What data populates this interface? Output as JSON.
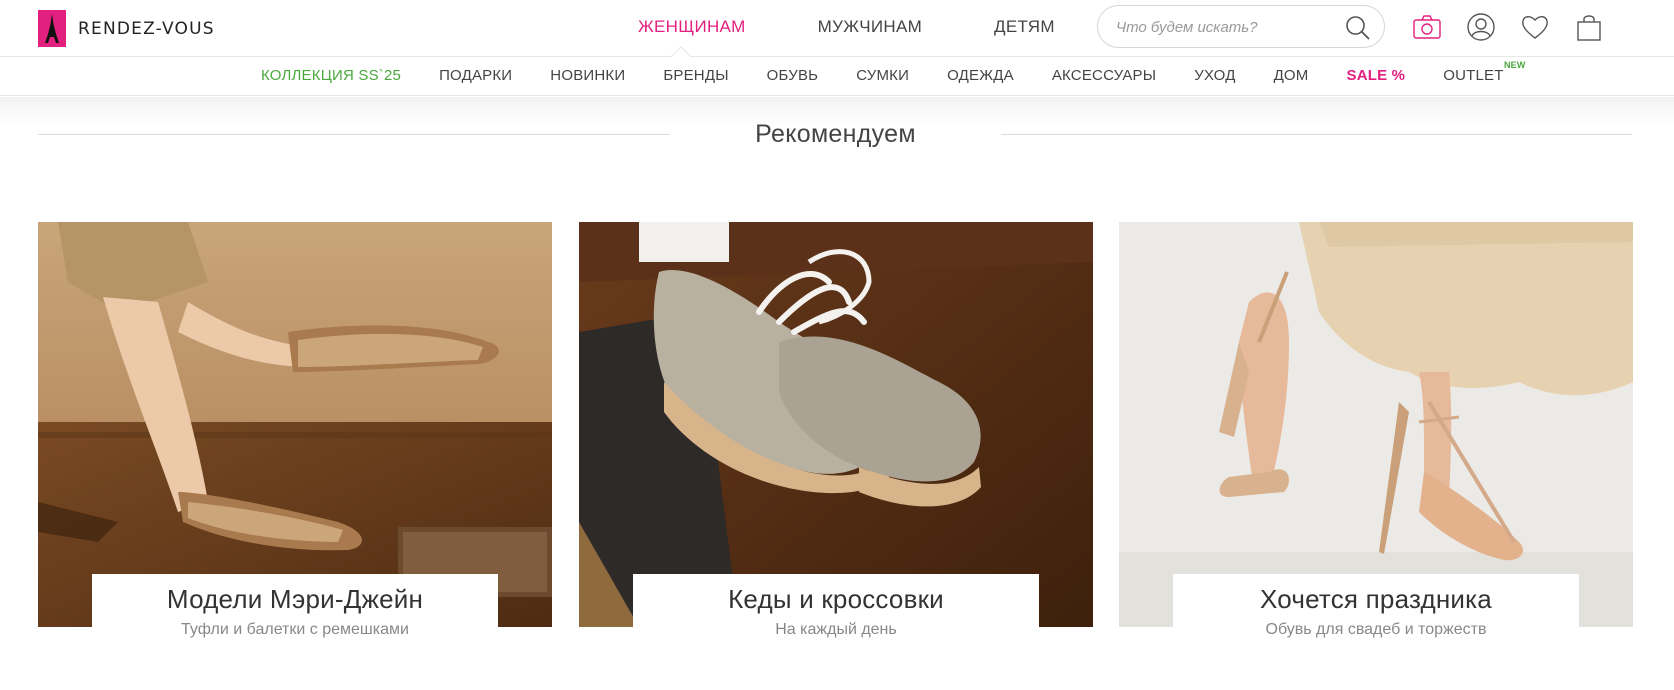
{
  "brand": {
    "name": "RENDEZ-VOUS"
  },
  "gender_nav": [
    {
      "label": "ЖЕНЩИНАМ",
      "active": true
    },
    {
      "label": "МУЖЧИНАМ",
      "active": false
    },
    {
      "label": "ДЕТЯМ",
      "active": false
    }
  ],
  "search": {
    "placeholder": "Что будем искать?"
  },
  "header_icons": [
    "camera-icon",
    "account-icon",
    "heart-icon",
    "bag-icon"
  ],
  "categories": [
    {
      "label": "КОЛЛЕКЦИЯ SS`25"
    },
    {
      "label": "ПОДАРКИ"
    },
    {
      "label": "НОВИНКИ"
    },
    {
      "label": "БРЕНДЫ"
    },
    {
      "label": "ОБУВЬ"
    },
    {
      "label": "СУМКИ"
    },
    {
      "label": "ОДЕЖДА"
    },
    {
      "label": "АКСЕССУАРЫ"
    },
    {
      "label": "УХОД"
    },
    {
      "label": "ДОМ"
    },
    {
      "label": "SALE %"
    },
    {
      "label": "OUTLET",
      "badge": "NEW"
    }
  ],
  "section": {
    "title": "Рекомендуем"
  },
  "cards": [
    {
      "title": "Модели Мэри-Джейн",
      "subtitle": "Туфли и балетки с ремешками"
    },
    {
      "title": "Кеды и кроссовки",
      "subtitle": "На каждый день"
    },
    {
      "title": "Хочется праздника",
      "subtitle": "Обувь для свадеб и торжеств"
    }
  ],
  "colors": {
    "accent": "#e2207f",
    "green": "#4aa83d"
  }
}
